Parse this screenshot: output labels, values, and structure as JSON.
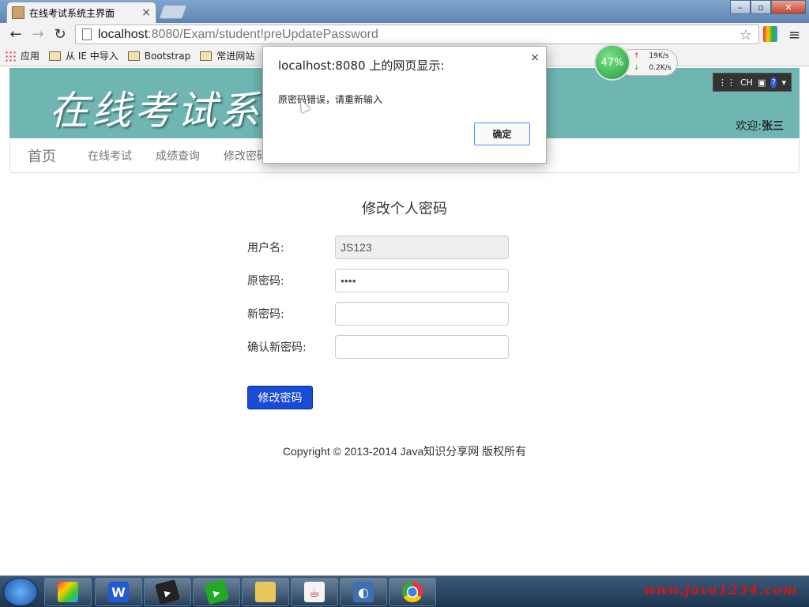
{
  "browser": {
    "tab_title": "在线考试系统主界面",
    "tab_close": "×",
    "address": {
      "host": "localhost",
      "rest": ":8080/Exam/student!preUpdatePassword"
    },
    "bookmarks": [
      "应用",
      "从 IE 中导入",
      "Bootstrap",
      "常进网站"
    ]
  },
  "window_controls": {
    "minimize": "–",
    "maximize": "▫",
    "close": "✕"
  },
  "header": {
    "banner_title": "在线考试系统",
    "ime": {
      "lang": "CH",
      "help": "?"
    },
    "welcome_label": "欢迎:",
    "username": "张三",
    "banner_color": "#6fb6b3"
  },
  "nav": {
    "brand": "首页",
    "links": [
      "在线考试",
      "成绩查询",
      "修改密码"
    ]
  },
  "form": {
    "title": "修改个人密码",
    "fields": [
      {
        "label": "用户名:",
        "value": "JS123",
        "readonly": true
      },
      {
        "label": "原密码:",
        "value": "••••",
        "readonly": false
      },
      {
        "label": "新密码:",
        "value": "",
        "readonly": false
      },
      {
        "label": "确认新密码:",
        "value": "",
        "readonly": false
      }
    ],
    "submit_label": "修改密码"
  },
  "footer": {
    "copyright": "Copyright © 2013-2014 Java知识分享网 版权所有"
  },
  "dialog": {
    "title": "localhost:8080 上的网页显示:",
    "close": "×",
    "message": "原密码错误，请重新输入",
    "ok_label": "确定"
  },
  "netmeter": {
    "percent": "47%",
    "up": "19K/s",
    "down": "0.2K/s"
  },
  "taskbar": {
    "watermark": "www.java1234.com"
  }
}
